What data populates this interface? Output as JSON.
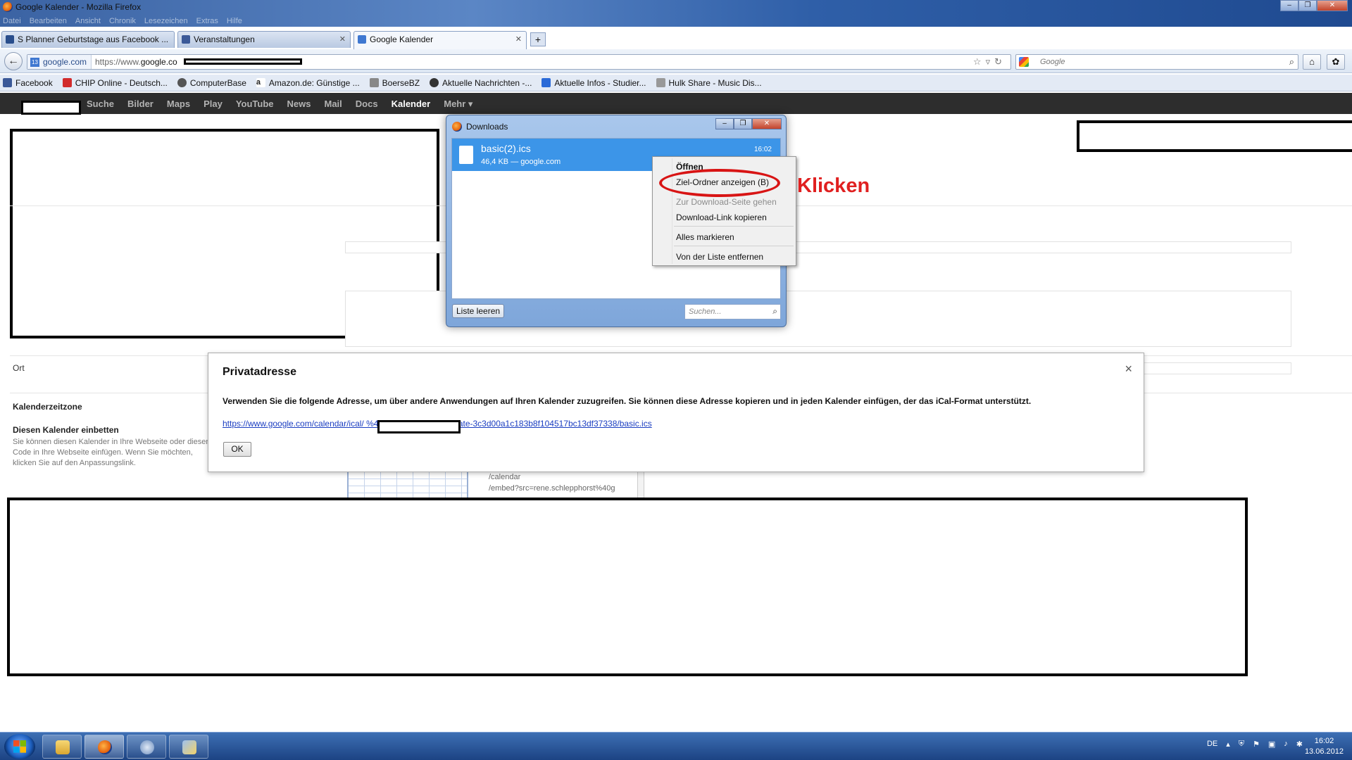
{
  "window": {
    "title": "Google Kalender - Mozilla Firefox",
    "menu": [
      "Datei",
      "Bearbeiten",
      "Ansicht",
      "Chronik",
      "Lesezeichen",
      "Extras",
      "Hilfe"
    ]
  },
  "tabs": [
    {
      "label": "S Planner Geburtstage aus Facebook ..."
    },
    {
      "label": "Veranstaltungen"
    },
    {
      "label": "Google Kalender"
    }
  ],
  "navbar": {
    "site": "google.com",
    "url_prefix": "https://www.",
    "url_domain": "google.co",
    "search_placeholder": "Google"
  },
  "bookmarks": [
    {
      "label": "Facebook",
      "color": "#3b5998"
    },
    {
      "label": "CHIP Online - Deutsch...",
      "color": "#d22b2b"
    },
    {
      "label": "ComputerBase",
      "color": "#555555"
    },
    {
      "label": "Amazon.de: Günstige ...",
      "color": "#222222"
    },
    {
      "label": "BoerseBZ",
      "color": "#666666"
    },
    {
      "label": "Aktuelle Nachrichten -...",
      "color": "#333333"
    },
    {
      "label": "Aktuelle Infos - Studier...",
      "color": "#2a6ad8"
    },
    {
      "label": "Hulk Share - Music Dis...",
      "color": "#777777"
    }
  ],
  "google_bar": {
    "links": [
      "Suche",
      "Bilder",
      "Maps",
      "Play",
      "YouTube",
      "News",
      "Mail",
      "Docs",
      "Kalender",
      "Mehr ▾"
    ],
    "active": "Kalender"
  },
  "settings": {
    "ort_label": "Ort",
    "timezone_label": "Kalenderzeitzone",
    "embed_label": "Diesen Kalender einbetten",
    "embed_help": "Sie können diesen Kalender in Ihre Webseite oder diesen Code in Ihre Webseite einfügen. Wenn Sie möchten, klicken Sie auf den Anpassungslink.",
    "embed_code_1": "/calendar",
    "embed_code_2": "/embed?src=rene.schlepphorst%40g"
  },
  "downloads": {
    "title": "Downloads",
    "item_name": "basic(2).ics",
    "item_meta": "46,4 KB — google.com",
    "item_time": "16:02",
    "clear_button": "Liste leeren",
    "search_placeholder": "Suchen..."
  },
  "context_menu": {
    "items": [
      "Öffnen",
      "Ziel-Ordner anzeigen (B)",
      "Zur Download-Seite gehen",
      "Download-Link kopieren",
      "Alles markieren",
      "Von der Liste entfernen"
    ]
  },
  "annotation": {
    "text": "Klicken",
    "color": "#e02020"
  },
  "dialog": {
    "title": "Privatadresse",
    "text": "Verwenden Sie die folgende Adresse, um über andere Anwendungen auf Ihren Kalender zuzugreifen. Sie können diese Adresse kopieren und in jeden Kalender einfügen, der das iCal-Format unterstützt.",
    "link": "https://www.google.com/calendar/ical/                        %40googlemail.com/private-3c3d00a1c183b8f104517bc13df37338/basic.ics",
    "ok": "OK",
    "close": "×"
  },
  "taskbar": {
    "lang": "DE",
    "time": "16:02",
    "date": "13.06.2012"
  }
}
